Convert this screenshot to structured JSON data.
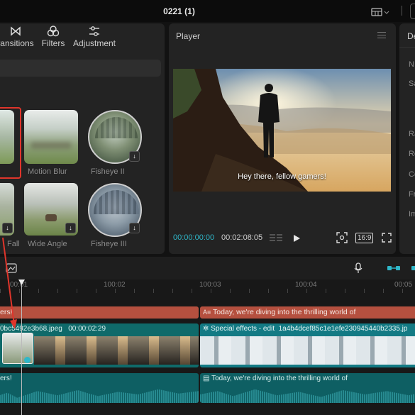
{
  "window": {
    "title": "0221 (1)"
  },
  "toolbar_tabs": [
    {
      "label": "ransitions",
      "icon": "transitions-icon"
    },
    {
      "label": "Filters",
      "icon": "filters-icon"
    },
    {
      "label": "Adjustment",
      "icon": "adjustment-icon"
    }
  ],
  "effects": {
    "items": [
      {
        "label": "Motion Blur"
      },
      {
        "label": "Fisheye II"
      },
      {
        "label": "Fall"
      },
      {
        "label": "Wide Angle"
      },
      {
        "label": "Fisheye III"
      }
    ]
  },
  "player": {
    "title": "Player",
    "subtitle": "Hey there, fellow gamers!",
    "current_time": "00:00:00:00",
    "total_time": "00:02:08:05",
    "aspect": "16:9"
  },
  "details": {
    "header_letter": "De",
    "field_letters": [
      "N",
      "Sa",
      "Ra",
      "Re",
      "Co",
      "Fr",
      "Im"
    ]
  },
  "timeline": {
    "ticks": [
      "00:01",
      "100:02",
      "100:03",
      "100:04",
      "00:05"
    ],
    "text_track_1": {
      "left_text": "ers!",
      "right_text": "Today, we're diving into the thrilling world of"
    },
    "video_clip_1": {
      "filename": "0bc5492e3b68.jpeg",
      "duration": "00:00:02:29"
    },
    "video_clip_2": {
      "title": "Special effects - edit",
      "filename": "1a4b4dcef85c1e1efe230945440b2335.jp"
    },
    "audio_track": {
      "left_text": "ers!",
      "right_text": "Today, we're diving into the thrilling world of"
    }
  },
  "colors": {
    "accent": "#2fb7c9",
    "highlight_red": "#e0352b",
    "text_track": "#b5503f",
    "teal_track": "#0f6a6a"
  }
}
